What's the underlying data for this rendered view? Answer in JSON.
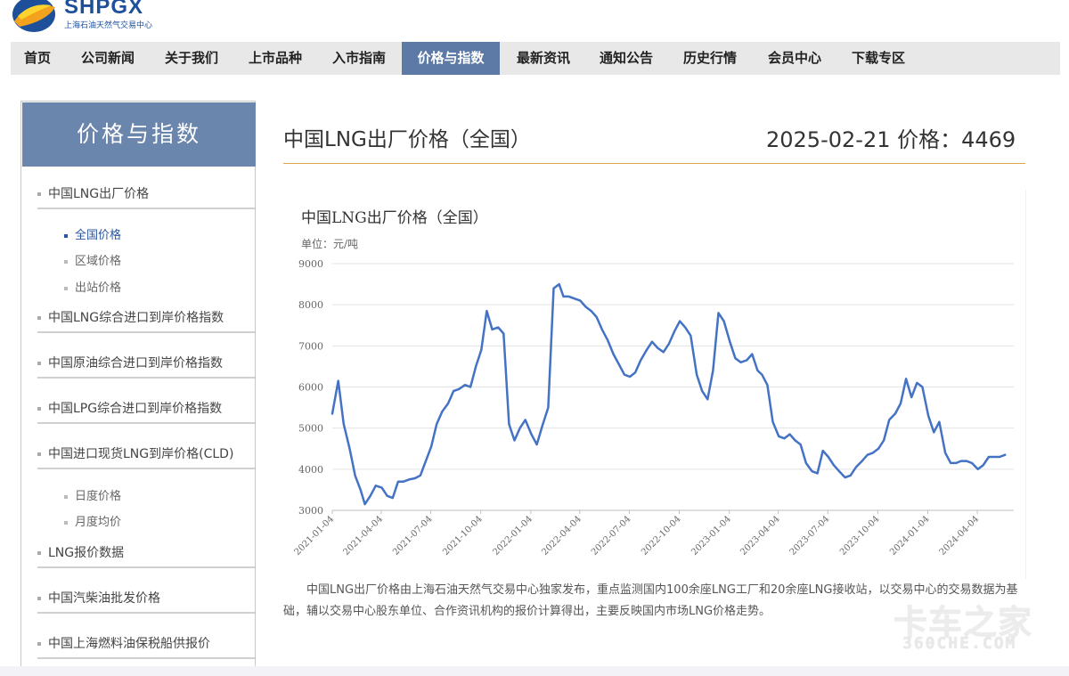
{
  "logo": {
    "name": "SHPGX",
    "subtitle": "上海石油天然气交易中心",
    "colors": {
      "blue": "#1d4f9a",
      "orange": "#f3a21d",
      "yellow": "#ffd22e"
    }
  },
  "nav": {
    "items": [
      {
        "label": "首页",
        "active": false
      },
      {
        "label": "公司新闻",
        "active": false
      },
      {
        "label": "关于我们",
        "active": false
      },
      {
        "label": "上市品种",
        "active": false
      },
      {
        "label": "入市指南",
        "active": false
      },
      {
        "label": "价格与指数",
        "active": true
      },
      {
        "label": "最新资讯",
        "active": false
      },
      {
        "label": "通知公告",
        "active": false
      },
      {
        "label": "历史行情",
        "active": false
      },
      {
        "label": "会员中心",
        "active": false
      },
      {
        "label": "下载专区",
        "active": false
      }
    ],
    "active_color": "#5d7aa6"
  },
  "sidebar": {
    "heading": "价格与指数",
    "items": [
      {
        "label": "中国LNG出厂价格"
      },
      {
        "label": "中国LNG综合进口到岸价格指数"
      },
      {
        "label": "中国原油综合进口到岸价格指数"
      },
      {
        "label": "中国LPG综合进口到岸价格指数"
      },
      {
        "label": "中国进口现货LNG到岸价格(CLD)"
      },
      {
        "label": "LNG报价数据"
      },
      {
        "label": "中国汽柴油批发价格"
      },
      {
        "label": "中国上海燃料油保税船供报价"
      }
    ],
    "lng_subitems": [
      {
        "label": "全国价格",
        "active": true
      },
      {
        "label": "区域价格",
        "active": false
      },
      {
        "label": "出站价格",
        "active": false
      }
    ],
    "cld_subitems": [
      {
        "label": "日度价格"
      },
      {
        "label": "月度均价"
      }
    ]
  },
  "main": {
    "title": "中国LNG出厂价格（全国）",
    "price_info": "2025-02-21 价格：4469",
    "description": "中国LNG出厂价格由上海石油天然气交易中心独家发布，重点监测国内100余座LNG工厂和20余座LNG接收站，以交易中心的交易数据为基础，辅以交易中心股东单位、合作资讯机构的报价计算得出，主要反映国内市场LNG价格走势。"
  },
  "chart_data": {
    "type": "line",
    "title": "中国LNG出厂价格（全国）",
    "unit_label": "单位：元/吨",
    "ylim": [
      3000,
      9000
    ],
    "yticks": [
      3000,
      4000,
      5000,
      6000,
      7000,
      8000,
      9000
    ],
    "x_tick_labels": [
      "2021-01-04",
      "2021-04-04",
      "2021-07-04",
      "2021-10-04",
      "2022-01-04",
      "2022-04-04",
      "2022-07-04",
      "2022-10-04",
      "2023-01-04",
      "2023-04-04",
      "2023-07-04",
      "2023-10-04",
      "2024-01-04",
      "2024-04-04"
    ],
    "grid": true,
    "line_color": "#4472c4",
    "series": [
      {
        "x": [
          "2021-01-04",
          "2021-01-15",
          "2021-01-25",
          "2021-02-05",
          "2021-02-15",
          "2021-02-25",
          "2021-03-05",
          "2021-03-15",
          "2021-03-25",
          "2021-04-05",
          "2021-04-15",
          "2021-04-25",
          "2021-05-05",
          "2021-05-15",
          "2021-05-25",
          "2021-06-05",
          "2021-06-15",
          "2021-06-25",
          "2021-07-05",
          "2021-07-15",
          "2021-07-25",
          "2021-08-05",
          "2021-08-15",
          "2021-08-25",
          "2021-09-05",
          "2021-09-15",
          "2021-09-25",
          "2021-10-05",
          "2021-10-15",
          "2021-10-25",
          "2021-11-05",
          "2021-11-15",
          "2021-11-25",
          "2021-12-05",
          "2021-12-15",
          "2021-12-25",
          "2022-01-05",
          "2022-01-15",
          "2022-01-25",
          "2022-02-05",
          "2022-02-15",
          "2022-02-25",
          "2022-03-05",
          "2022-03-15",
          "2022-03-25",
          "2022-04-05",
          "2022-04-15",
          "2022-04-25",
          "2022-05-05",
          "2022-05-15",
          "2022-05-25",
          "2022-06-05",
          "2022-06-15",
          "2022-06-25",
          "2022-07-05",
          "2022-07-15",
          "2022-07-25",
          "2022-08-05",
          "2022-08-15",
          "2022-08-25",
          "2022-09-05",
          "2022-09-15",
          "2022-09-25",
          "2022-10-05",
          "2022-10-15",
          "2022-10-25",
          "2022-11-05",
          "2022-11-15",
          "2022-11-25",
          "2022-12-05",
          "2022-12-15",
          "2022-12-25",
          "2023-01-05",
          "2023-01-15",
          "2023-01-25",
          "2023-02-05",
          "2023-02-15",
          "2023-02-25",
          "2023-03-05",
          "2023-03-15",
          "2023-03-25",
          "2023-04-05",
          "2023-04-15",
          "2023-04-25",
          "2023-05-05",
          "2023-05-15",
          "2023-05-25",
          "2023-06-05",
          "2023-06-15",
          "2023-06-25",
          "2023-07-05",
          "2023-07-15",
          "2023-07-25",
          "2023-08-05",
          "2023-08-15",
          "2023-08-25",
          "2023-09-05",
          "2023-09-15",
          "2023-09-25",
          "2023-10-05",
          "2023-10-15",
          "2023-10-25",
          "2023-11-05",
          "2023-11-15",
          "2023-11-25",
          "2023-12-05",
          "2023-12-15",
          "2023-12-25",
          "2024-01-05",
          "2024-01-15",
          "2024-01-25",
          "2024-02-05",
          "2024-02-15",
          "2024-02-25",
          "2024-03-05",
          "2024-03-15",
          "2024-03-25",
          "2024-04-05",
          "2024-04-15",
          "2024-04-25",
          "2024-05-05",
          "2024-05-15",
          "2024-05-25"
        ],
        "values": [
          5350,
          6150,
          5100,
          4500,
          3850,
          3500,
          3150,
          3350,
          3600,
          3550,
          3350,
          3300,
          3700,
          3700,
          3750,
          3780,
          3850,
          4200,
          4550,
          5100,
          5400,
          5600,
          5900,
          5950,
          6050,
          6000,
          6500,
          6900,
          7850,
          7400,
          7450,
          7300,
          5100,
          4700,
          5000,
          5200,
          4850,
          4600,
          5050,
          5500,
          8400,
          8500,
          8200,
          8200,
          8150,
          8100,
          7950,
          7850,
          7700,
          7400,
          7150,
          6800,
          6550,
          6300,
          6250,
          6350,
          6650,
          6900,
          7100,
          6950,
          6850,
          7050,
          7350,
          7600,
          7450,
          7250,
          6300,
          5900,
          5700,
          6400,
          7800,
          7600,
          7100,
          6700,
          6600,
          6650,
          6800,
          6400,
          6300,
          6050,
          5150,
          4800,
          4750,
          4850,
          4700,
          4600,
          4150,
          3950,
          3900,
          4450,
          4300,
          4100,
          3950,
          3800,
          3850,
          4050,
          4200,
          4350,
          4400,
          4500,
          4700,
          5200,
          5350,
          5600,
          6200,
          5750,
          6100,
          6000,
          5300,
          4900,
          5150,
          4400,
          4150,
          4150,
          4200,
          4200,
          4150,
          4000,
          4100,
          4300,
          4300,
          4300,
          4350
        ]
      }
    ]
  },
  "watermark": {
    "main": "卡车之家",
    "sub": "360CHE.COM"
  }
}
